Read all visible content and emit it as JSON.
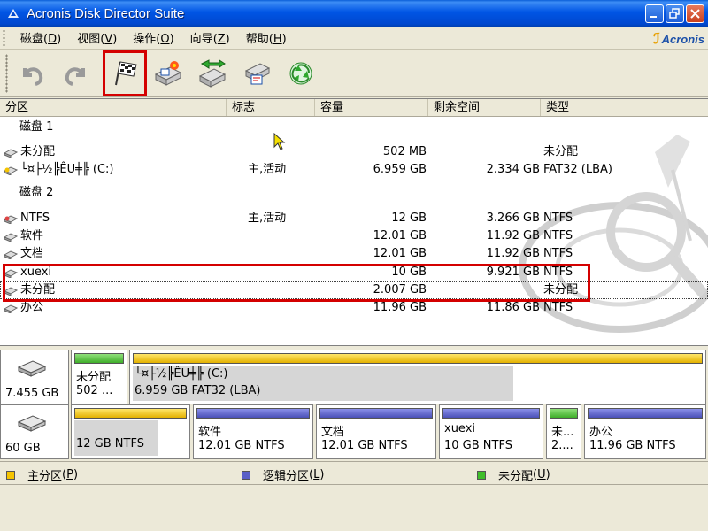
{
  "window": {
    "title": "Acronis Disk Director Suite"
  },
  "menu": [
    {
      "label": "磁盘",
      "key": "D"
    },
    {
      "label": "视图",
      "key": "V"
    },
    {
      "label": "操作",
      "key": "O"
    },
    {
      "label": "向导",
      "key": "Z"
    },
    {
      "label": "帮助",
      "key": "H"
    }
  ],
  "brand": {
    "logo_text": "Acronis"
  },
  "toolbar": {
    "buttons": [
      "undo-icon",
      "redo-icon",
      "commit-flag-icon",
      "create-partition-icon",
      "copy-partition-icon",
      "recover-partition-icon",
      "recycle-icon"
    ]
  },
  "columns": {
    "partition": "分区",
    "flags": "标志",
    "capacity": "容量",
    "free": "剩余空间",
    "type": "类型"
  },
  "rows": [
    {
      "kind": "group",
      "name": "磁盘 1"
    },
    {
      "kind": "part",
      "name": "未分配",
      "flags": "",
      "capacity": "502 MB",
      "free": "",
      "type": "未分配"
    },
    {
      "kind": "part",
      "name": "└¤├½╠ÊU╪╠ (C:)",
      "flags": "主,活动",
      "capacity": "6.959 GB",
      "free": "2.334 GB",
      "type": "FAT32 (LBA)"
    },
    {
      "kind": "group",
      "name": "磁盘 2"
    },
    {
      "kind": "part",
      "name": "NTFS",
      "flags": "主,活动",
      "capacity": "12 GB",
      "free": "3.266 GB",
      "type": "NTFS"
    },
    {
      "kind": "part",
      "name": "软件",
      "flags": "",
      "capacity": "12.01 GB",
      "free": "11.92 GB",
      "type": "NTFS"
    },
    {
      "kind": "part",
      "name": "文档",
      "flags": "",
      "capacity": "12.01 GB",
      "free": "11.92 GB",
      "type": "NTFS"
    },
    {
      "kind": "part",
      "name": "xuexi",
      "flags": "",
      "capacity": "10 GB",
      "free": "9.921 GB",
      "type": "NTFS"
    },
    {
      "kind": "part",
      "name": "未分配",
      "flags": "",
      "capacity": "2.007 GB",
      "free": "",
      "type": "未分配"
    },
    {
      "kind": "part",
      "name": "办公",
      "flags": "",
      "capacity": "11.96 GB",
      "free": "11.86 GB",
      "type": "NTFS"
    }
  ],
  "disk_map": {
    "disk1": {
      "size": "7.455 GB",
      "parts": [
        {
          "line1": "未分配",
          "line2": "502 ...",
          "bar": "green",
          "used": 0
        },
        {
          "line1": "└¤├½╠ÊU╪╠ (C:)",
          "line2": "6.959 GB  FAT32 (LBA)",
          "bar": "yellow",
          "used": 0.66
        }
      ]
    },
    "disk2": {
      "size": "60 GB",
      "parts": [
        {
          "line1": "",
          "line2": "12 GB  NTFS",
          "bar": "yellow",
          "used": 0.72
        },
        {
          "line1": "软件",
          "line2": "12.01 GB  NTFS",
          "bar": "blue",
          "used": 0.0
        },
        {
          "line1": "文档",
          "line2": "12.01 GB  NTFS",
          "bar": "blue",
          "used": 0.0
        },
        {
          "line1": "xuexi",
          "line2": "10 GB  NTFS",
          "bar": "blue",
          "used": 0.0
        },
        {
          "line1": "未...",
          "line2": "2....",
          "bar": "green",
          "used": 0
        },
        {
          "line1": "办公",
          "line2": "11.96 GB  NTFS",
          "bar": "blue",
          "used": 0.0
        }
      ]
    }
  },
  "legend": {
    "primary": {
      "label": "主分区",
      "key": "P",
      "color": "#f5c400"
    },
    "logical": {
      "label": "逻辑分区",
      "key": "L",
      "color": "#5a60c8"
    },
    "unallocated": {
      "label": "未分配",
      "key": "U",
      "color": "#3fbe2a"
    }
  }
}
